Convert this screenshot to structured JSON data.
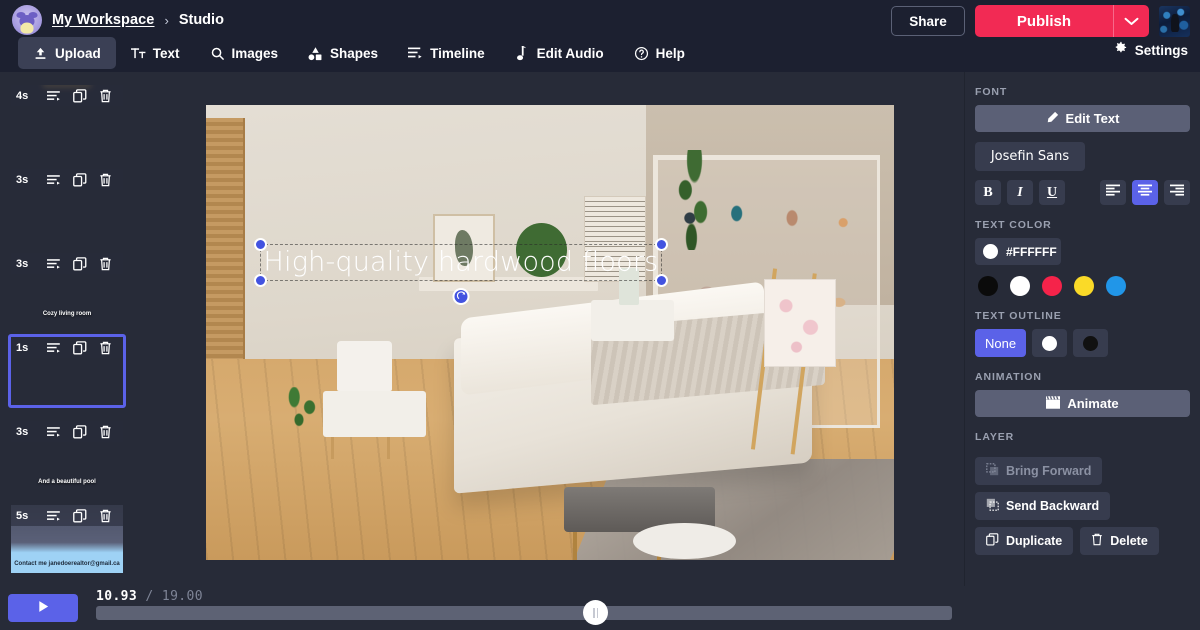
{
  "header": {
    "workspace": "My Workspace",
    "separator": "›",
    "current": "Studio",
    "avatar_icon": "cat-avatar-icon",
    "user_avatar_icon": "user-avatar-icon",
    "share_label": "Share",
    "publish_label": "Publish",
    "publish_caret_icon": "chevron-down-icon",
    "settings_label": "Settings",
    "settings_icon": "gear-icon",
    "accent_publish": "#f22a54",
    "menu": [
      {
        "label": "Upload",
        "icon": "upload-icon",
        "active": true
      },
      {
        "label": "Text",
        "icon": "text-icon",
        "active": false
      },
      {
        "label": "Images",
        "icon": "search-icon",
        "active": false
      },
      {
        "label": "Shapes",
        "icon": "shapes-icon",
        "active": false
      },
      {
        "label": "Timeline",
        "icon": "timeline-icon",
        "active": false
      },
      {
        "label": "Edit Audio",
        "icon": "music-note-icon",
        "active": false
      },
      {
        "label": "Help",
        "icon": "help-circle-icon",
        "active": false
      }
    ]
  },
  "slides": [
    {
      "duration": "4s",
      "caption": "",
      "art": "art-house",
      "selected": false,
      "band": false
    },
    {
      "duration": "3s",
      "caption": "",
      "art": "art-kitchen",
      "selected": false,
      "band": false
    },
    {
      "duration": "3s",
      "caption": "Cozy living room",
      "art": "art-living",
      "selected": false,
      "band": false
    },
    {
      "duration": "1s",
      "caption": "",
      "art": "art-bed",
      "selected": true,
      "band": false
    },
    {
      "duration": "3s",
      "caption": "And a beautiful pool",
      "art": "art-pool",
      "selected": false,
      "band": false
    },
    {
      "duration": "5s",
      "caption": "Contact me\njanedoerealtor@gmail.ca",
      "art": "art-contact",
      "selected": false,
      "band": true
    }
  ],
  "slide_icons": {
    "reorder": "reorder-icon",
    "duplicate": "duplicate-icon",
    "delete": "trash-icon"
  },
  "canvas": {
    "overlay_text": "High-quality hardwood floors",
    "rotate_icon": "rotate-icon",
    "handle_color": "#4353e0"
  },
  "panel": {
    "font_label": "FONT",
    "edit_text_label": "Edit Text",
    "edit_text_icon": "pencil-icon",
    "font_family_value": "Josefin Sans",
    "bold_label": "B",
    "italic_label": "I",
    "underline_label": "U",
    "align_left_icon": "align-left-icon",
    "align_center_icon": "align-center-icon",
    "align_right_icon": "align-right-icon",
    "active_align": "center",
    "text_color_label": "TEXT COLOR",
    "text_color_value": "#FFFFFF",
    "swatches": [
      "#0b0b0b",
      "#ffffff",
      "#f5234a",
      "#fada28",
      "#2196e8"
    ],
    "text_outline_label": "TEXT OUTLINE",
    "outline_none_label": "None",
    "outline_white": "#ffffff",
    "outline_black": "#111111",
    "animation_label": "ANIMATION",
    "animate_label": "Animate",
    "animate_icon": "clapperboard-icon",
    "layer_label": "LAYER",
    "bring_forward_label": "Bring Forward",
    "bring_forward_icon": "bring-forward-icon",
    "send_backward_label": "Send Backward",
    "send_backward_icon": "send-backward-icon",
    "duplicate_label": "Duplicate",
    "duplicate_icon": "duplicate-icon",
    "delete_label": "Delete",
    "delete_icon": "trash-icon",
    "accent_active": "#5b62e8"
  },
  "transport": {
    "play_icon": "play-icon",
    "current_time": "10.93",
    "time_separator": "/",
    "total_time": "19.00",
    "progress_percent": 57.5
  }
}
